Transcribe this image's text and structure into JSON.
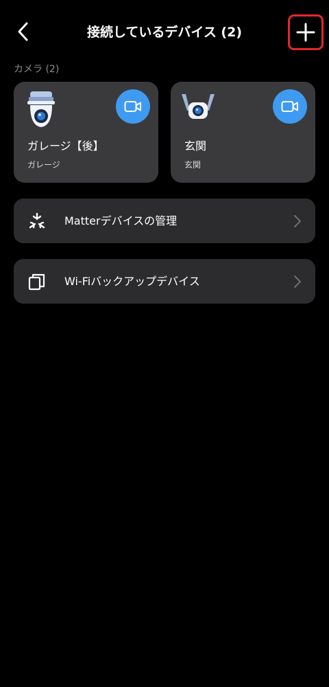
{
  "header": {
    "title": "接続しているデバイス (2)",
    "back_icon": "chevron-left-icon",
    "add_icon": "plus-icon",
    "add_highlight_color": "#e6262e"
  },
  "cameras": {
    "section_label": "カメラ (2)",
    "items": [
      {
        "name": "ガレージ【後】",
        "location": "ガレージ",
        "icon": "pan-tilt-camera-icon",
        "action_icon": "video-camera-icon"
      },
      {
        "name": "玄関",
        "location": "玄関",
        "icon": "outdoor-camera-icon",
        "action_icon": "video-camera-icon"
      }
    ]
  },
  "menu": [
    {
      "label": "Matterデバイスの管理",
      "icon": "matter-icon",
      "chevron": "chevron-right-icon"
    },
    {
      "label": "Wi-Fiバックアップデバイス",
      "icon": "copy-icon",
      "chevron": "chevron-right-icon"
    }
  ],
  "colors": {
    "background": "#000000",
    "card": "#3a3a3c",
    "row": "#2c2c2e",
    "accent": "#3e9bf1"
  }
}
